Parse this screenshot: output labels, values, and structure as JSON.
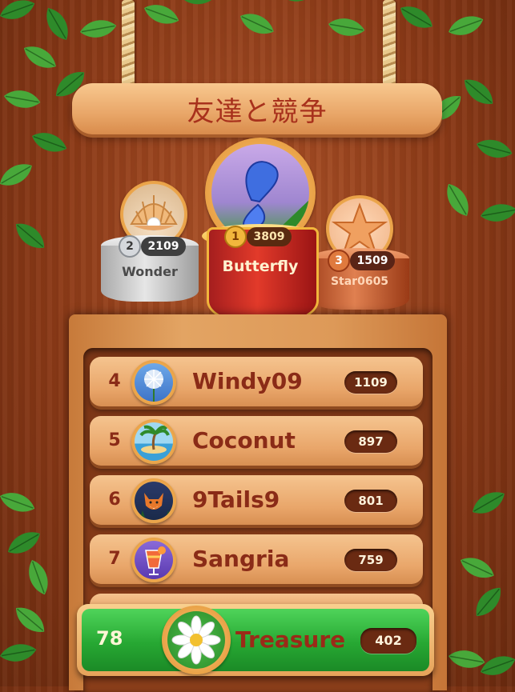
{
  "title": "友達と競争",
  "podium": [
    {
      "place": "2",
      "score": "2109",
      "name": "Wonder",
      "avatar_icon": "pearl-shell-icon"
    },
    {
      "place": "1",
      "score": "3809",
      "name": "Butterfly",
      "avatar_icon": "butterfly-icon"
    },
    {
      "place": "3",
      "score": "1509",
      "name": "Star0605",
      "avatar_icon": "starfish-icon"
    }
  ],
  "rows": [
    {
      "rank": "4",
      "name": "Windy09",
      "score": "1109",
      "avatar_icon": "dandelion-icon"
    },
    {
      "rank": "5",
      "name": "Coconut",
      "score": "897",
      "avatar_icon": "palm-island-icon"
    },
    {
      "rank": "6",
      "name": "9Tails9",
      "score": "801",
      "avatar_icon": "fox-icon"
    },
    {
      "rank": "7",
      "name": "Sangria",
      "score": "759",
      "avatar_icon": "cocktail-icon"
    }
  ],
  "me": {
    "rank": "78",
    "name": "Treasure",
    "score": "402",
    "avatar_icon": "daisy-icon"
  },
  "colors": {
    "wood": "#8c3a17",
    "plank": "#e9a66a",
    "name_text": "#8a2b17",
    "player_green": "#27a833",
    "gold": "#f2b63c"
  }
}
